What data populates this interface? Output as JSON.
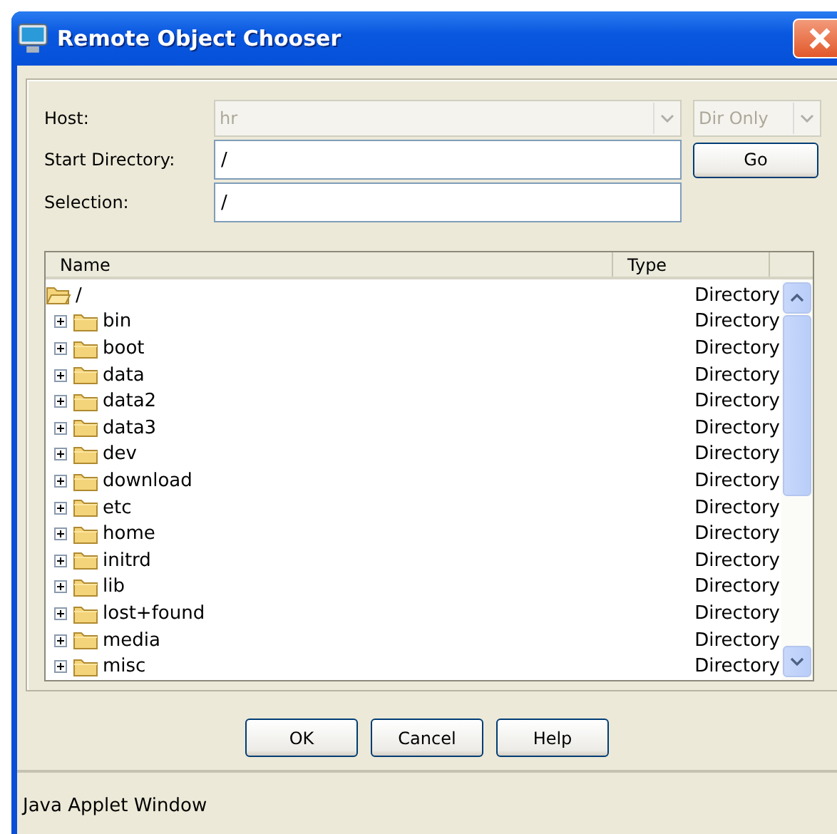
{
  "window": {
    "title": "Remote Object Chooser"
  },
  "form": {
    "host": {
      "label": "Host:",
      "value": "hr",
      "disabled": true
    },
    "filter": {
      "value": "Dir Only",
      "disabled": true
    },
    "start_directory": {
      "label": "Start Directory:",
      "value": "/"
    },
    "selection": {
      "label": "Selection:",
      "value": "/"
    },
    "go_button": "Go"
  },
  "tree": {
    "columns": [
      "Name",
      "Type"
    ],
    "root": {
      "name": "/",
      "type": "Directory",
      "expanded": true,
      "children": [
        {
          "name": "bin",
          "type": "Directory",
          "expanded": false
        },
        {
          "name": "boot",
          "type": "Directory",
          "expanded": false
        },
        {
          "name": "data",
          "type": "Directory",
          "expanded": false
        },
        {
          "name": "data2",
          "type": "Directory",
          "expanded": false
        },
        {
          "name": "data3",
          "type": "Directory",
          "expanded": false
        },
        {
          "name": "dev",
          "type": "Directory",
          "expanded": false
        },
        {
          "name": "download",
          "type": "Directory",
          "expanded": false
        },
        {
          "name": "etc",
          "type": "Directory",
          "expanded": false
        },
        {
          "name": "home",
          "type": "Directory",
          "expanded": false
        },
        {
          "name": "initrd",
          "type": "Directory",
          "expanded": false
        },
        {
          "name": "lib",
          "type": "Directory",
          "expanded": false
        },
        {
          "name": "lost+found",
          "type": "Directory",
          "expanded": false
        },
        {
          "name": "media",
          "type": "Directory",
          "expanded": false
        },
        {
          "name": "misc",
          "type": "Directory",
          "expanded": false
        }
      ]
    }
  },
  "buttons": [
    "OK",
    "Cancel",
    "Help"
  ],
  "status_bar": "Java Applet Window"
}
